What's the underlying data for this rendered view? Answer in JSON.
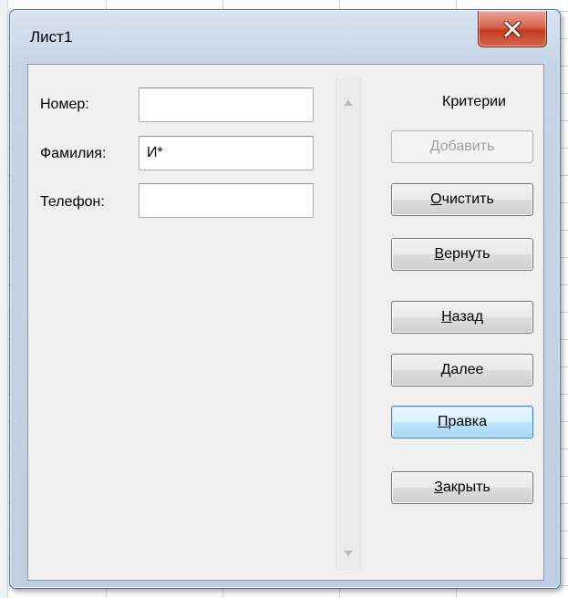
{
  "window": {
    "title": "Лист1"
  },
  "fields": [
    {
      "label": "Номер:",
      "value": ""
    },
    {
      "label": "Фамилия:",
      "value": "И*"
    },
    {
      "label": "Телефон:",
      "value": ""
    }
  ],
  "criteria_label": "Критерии",
  "buttons": {
    "add": {
      "label": "Добавить",
      "enabled": false
    },
    "clear": {
      "accel": "О",
      "rest": "чистить"
    },
    "restore": {
      "accel": "В",
      "rest": "ернуть"
    },
    "back": {
      "accel": "Н",
      "rest": "азад"
    },
    "next": {
      "accel": "Д",
      "rest": "алее"
    },
    "edit": {
      "accel": "П",
      "rest": "равка",
      "focused": true
    },
    "close": {
      "accel": "З",
      "rest": "акрыть"
    }
  },
  "icons": {
    "close": "close-x-icon",
    "scroll_up": "scroll-up-arrow-icon",
    "scroll_down": "scroll-down-arrow-icon"
  },
  "colors": {
    "close_button": "#c23a1f",
    "focused_button": "#a7d9f5",
    "window_frame": "#c6d5e6"
  }
}
